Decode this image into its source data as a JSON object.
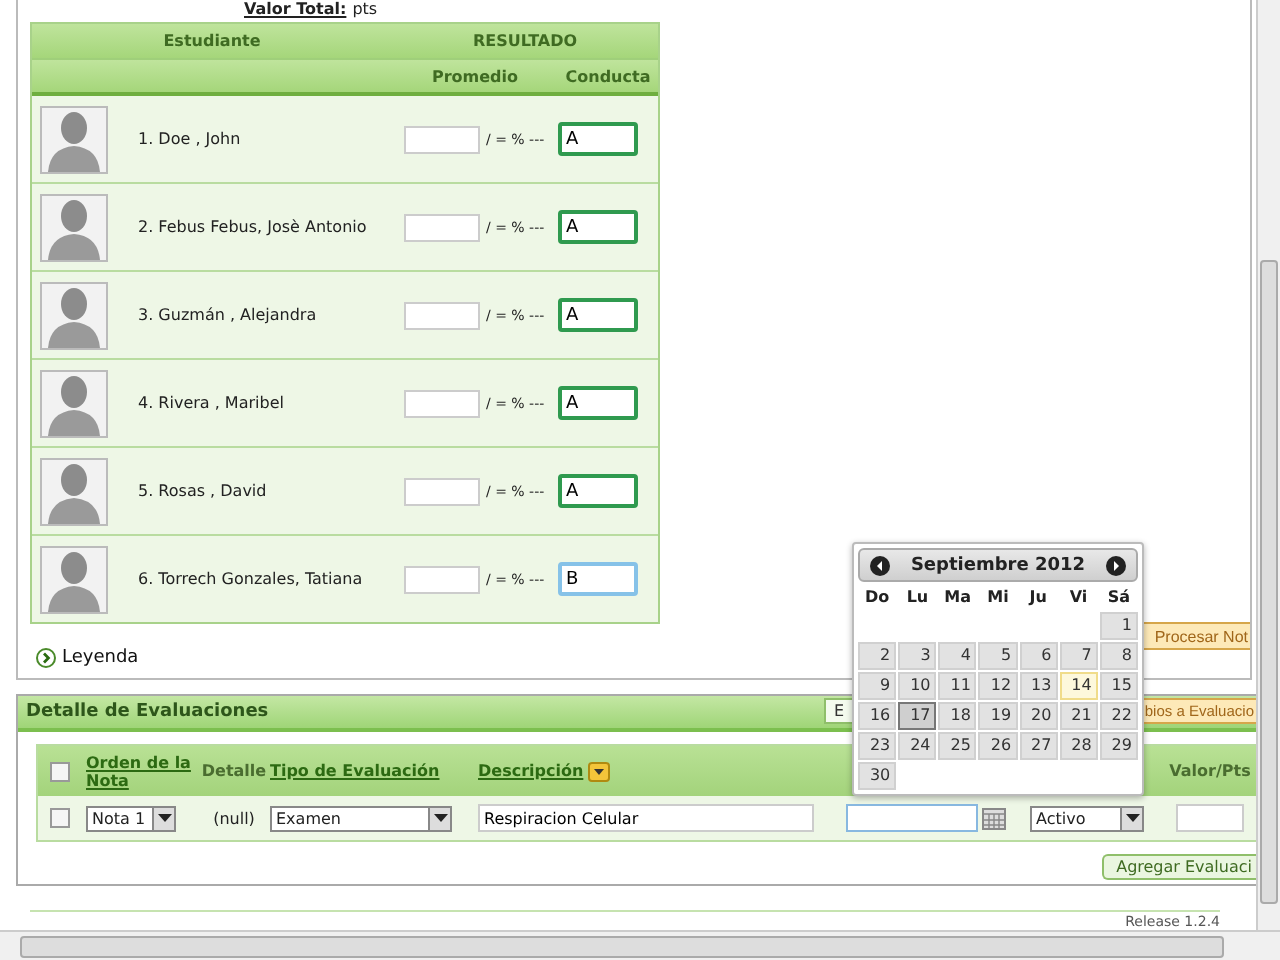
{
  "summary": {
    "label": "Valor Total:",
    "value": "pts"
  },
  "grades_table": {
    "group_headers": [
      "Estudiante",
      "RESULTADO"
    ],
    "sub_headers": [
      "Promedio",
      "Conducta"
    ],
    "rows": [
      {
        "name": "1. Doe , John",
        "average_suffix": "/ = % ---",
        "conduct": "A",
        "focused": false
      },
      {
        "name": "2. Febus Febus, Josè Antonio",
        "average_suffix": "/ = % ---",
        "conduct": "A",
        "focused": false
      },
      {
        "name": "3. Guzmán , Alejandra",
        "average_suffix": "/ = % ---",
        "conduct": "A",
        "focused": false
      },
      {
        "name": "4. Rivera , Maribel",
        "average_suffix": "/ = % ---",
        "conduct": "A",
        "focused": false
      },
      {
        "name": "5. Rosas , David",
        "average_suffix": "/ = % ---",
        "conduct": "A",
        "focused": false
      },
      {
        "name": "6. Torrech Gonzales, Tatiana",
        "average_suffix": "/ = % ---",
        "conduct": "B",
        "focused": true
      }
    ]
  },
  "legend_link": "Leyenda",
  "process_button": "Procesar Not",
  "evaluations": {
    "title": "Detalle de Evaluaciones",
    "buttons": [
      "E",
      "bios a Evaluacio"
    ],
    "columns": [
      {
        "label": "Orden de la Nota",
        "kind": "link"
      },
      {
        "label": "Detalle",
        "kind": "plain"
      },
      {
        "label": "Tipo de Evaluación",
        "kind": "link"
      },
      {
        "label": "Descripción",
        "kind": "sort"
      },
      {
        "label": "Valor/Pts",
        "kind": "plain"
      }
    ],
    "header_checked": false,
    "rows": [
      {
        "checked": false,
        "order": "Nota 1",
        "detail": "(null)",
        "type": "Examen",
        "description": "Respiracion Celular",
        "status": "Activo"
      }
    ],
    "add_button": "Agregar Evaluaci"
  },
  "release": "Release 1.2.4",
  "calendar": {
    "title": "Septiembre 2012",
    "weekdays": [
      "Do",
      "Lu",
      "Ma",
      "Mi",
      "Ju",
      "Vi",
      "Sá"
    ],
    "weeks": [
      {
        "kind": "start",
        "days": [
          {
            "d": "1",
            "today": false,
            "selected": false
          }
        ]
      },
      {
        "kind": "full",
        "days": [
          {
            "d": "2",
            "today": false,
            "selected": false
          },
          {
            "d": "3",
            "today": false,
            "selected": false
          },
          {
            "d": "4",
            "today": false,
            "selected": false
          },
          {
            "d": "5",
            "today": false,
            "selected": false
          },
          {
            "d": "6",
            "today": false,
            "selected": false
          },
          {
            "d": "7",
            "today": false,
            "selected": false
          },
          {
            "d": "8",
            "today": false,
            "selected": false
          }
        ]
      },
      {
        "kind": "full",
        "days": [
          {
            "d": "9",
            "today": false,
            "selected": false
          },
          {
            "d": "10",
            "today": false,
            "selected": false
          },
          {
            "d": "11",
            "today": false,
            "selected": false
          },
          {
            "d": "12",
            "today": false,
            "selected": false
          },
          {
            "d": "13",
            "today": false,
            "selected": false
          },
          {
            "d": "14",
            "today": true,
            "selected": false
          },
          {
            "d": "15",
            "today": false,
            "selected": false
          }
        ]
      },
      {
        "kind": "full",
        "days": [
          {
            "d": "16",
            "today": false,
            "selected": false
          },
          {
            "d": "17",
            "today": false,
            "selected": true
          },
          {
            "d": "18",
            "today": false,
            "selected": false
          },
          {
            "d": "19",
            "today": false,
            "selected": false
          },
          {
            "d": "20",
            "today": false,
            "selected": false
          },
          {
            "d": "21",
            "today": false,
            "selected": false
          },
          {
            "d": "22",
            "today": false,
            "selected": false
          }
        ]
      },
      {
        "kind": "full",
        "days": [
          {
            "d": "23",
            "today": false,
            "selected": false
          },
          {
            "d": "24",
            "today": false,
            "selected": false
          },
          {
            "d": "25",
            "today": false,
            "selected": false
          },
          {
            "d": "26",
            "today": false,
            "selected": false
          },
          {
            "d": "27",
            "today": false,
            "selected": false
          },
          {
            "d": "28",
            "today": false,
            "selected": false
          },
          {
            "d": "29",
            "today": false,
            "selected": false
          }
        ]
      },
      {
        "kind": "end",
        "days": [
          {
            "d": "30",
            "today": false,
            "selected": false
          }
        ]
      }
    ]
  }
}
